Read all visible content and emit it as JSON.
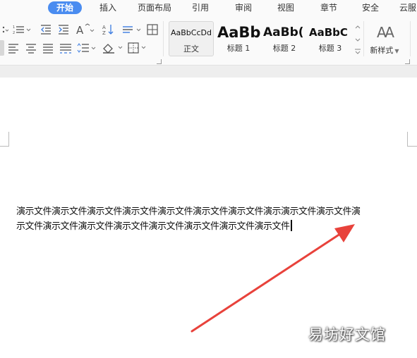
{
  "menu": {
    "tabs": [
      {
        "label": "开始",
        "active": true
      },
      {
        "label": "插入"
      },
      {
        "label": "页面布局"
      },
      {
        "label": "引用"
      },
      {
        "label": "审阅"
      },
      {
        "label": "视图"
      },
      {
        "label": "章节"
      },
      {
        "label": "安全"
      },
      {
        "label": "云服"
      }
    ]
  },
  "ribbon": {
    "paragraph_icons_row1": [
      "list-ordered-icon",
      "decrease-indent-icon",
      "increase-indent-icon",
      "text-style-icon",
      "sort-icon",
      "chinese-layout-icon",
      "show-marks-icon"
    ],
    "paragraph_icons_row2": [
      "align-left-icon",
      "align-center-icon",
      "align-justify-icon",
      "distributed-icon",
      "line-spacing-icon",
      "shading-icon",
      "border-icon"
    ],
    "styles": [
      {
        "preview": "AaBbCcDd",
        "label": "正文",
        "selected": true
      },
      {
        "preview": "AaBb",
        "label": "标题 1"
      },
      {
        "preview": "AaBb(",
        "label": "标题 2"
      },
      {
        "preview": "AaBbC",
        "label": "标题 3"
      }
    ],
    "new_style": {
      "label": "新样式",
      "icon": "AA"
    }
  },
  "document": {
    "lines": [
      "演示文件演示文件演示文件演示文件演示文件演示文件演示文件演示演示文件演示文件演",
      "示文件演示文件演示文件演示文件演示文件演示文件演示文件演示文件"
    ]
  },
  "annotation": {
    "color": "#e8423b"
  },
  "watermark": {
    "text": "易坊好文馆"
  },
  "colors": {
    "accent": "#4a8cf0",
    "arrow": "#e8423b"
  }
}
